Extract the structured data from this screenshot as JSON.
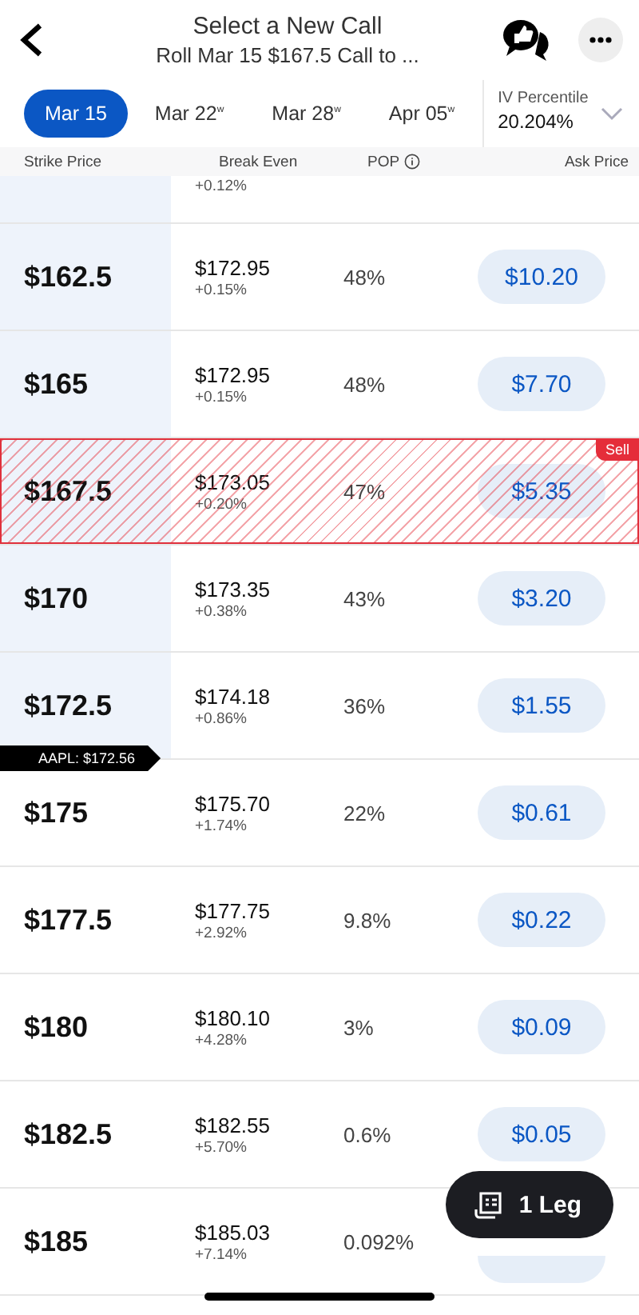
{
  "header": {
    "title": "Select a New Call",
    "subtitle": "Roll Mar 15 $167.5 Call to ..."
  },
  "tabs": [
    {
      "label": "Mar 15",
      "selected": true
    },
    {
      "label": "Mar 22$^{w}$",
      "selected": false
    },
    {
      "label": "Mar 28$^{w}$",
      "selected": false
    },
    {
      "label": "Apr 05$^{w}$",
      "selected": false
    }
  ],
  "iv": {
    "label": "IV Percentile",
    "value": "20.204%"
  },
  "columns": [
    "Strike Price",
    "Break Even",
    "POP",
    "Ask Price"
  ],
  "top_row": {
    "change": "+0.12%"
  },
  "rows": [
    {
      "strike": "$162.5",
      "break_even": "$172.95",
      "change": "+0.15%",
      "pop": "48%",
      "ask": "$10.20",
      "itm": true,
      "selected": false
    },
    {
      "strike": "$165",
      "break_even": "$172.95",
      "change": "+0.15%",
      "pop": "48%",
      "ask": "$7.70",
      "itm": true,
      "selected": false
    },
    {
      "strike": "$167.5",
      "break_even": "$173.05",
      "change": "+0.20%",
      "pop": "47%",
      "ask": "$5.35",
      "itm": true,
      "selected": true,
      "badge": "Sell"
    },
    {
      "strike": "$170",
      "break_even": "$173.35",
      "change": "+0.38%",
      "pop": "43%",
      "ask": "$3.20",
      "itm": true,
      "selected": false
    },
    {
      "strike": "$172.5",
      "break_even": "$174.18",
      "change": "+0.86%",
      "pop": "36%",
      "ask": "$1.55",
      "itm": true,
      "selected": false,
      "price_marker": "AAPL: $172.56"
    },
    {
      "strike": "$175",
      "break_even": "$175.70",
      "change": "+1.74%",
      "pop": "22%",
      "ask": "$0.61",
      "itm": false,
      "selected": false
    },
    {
      "strike": "$177.5",
      "break_even": "$177.75",
      "change": "+2.92%",
      "pop": "9.8%",
      "ask": "$0.22",
      "itm": false,
      "selected": false
    },
    {
      "strike": "$180",
      "break_even": "$180.10",
      "change": "+4.28%",
      "pop": "3%",
      "ask": "$0.09",
      "itm": false,
      "selected": false
    },
    {
      "strike": "$182.5",
      "break_even": "$182.55",
      "change": "+5.70%",
      "pop": "0.6%",
      "ask": "$0.05",
      "itm": false,
      "selected": false
    },
    {
      "strike": "$185",
      "break_even": "$185.03",
      "change": "+7.14%",
      "pop": "0.092%",
      "itm": false,
      "selected": false
    }
  ],
  "legs_button": {
    "label": "1 Leg"
  }
}
